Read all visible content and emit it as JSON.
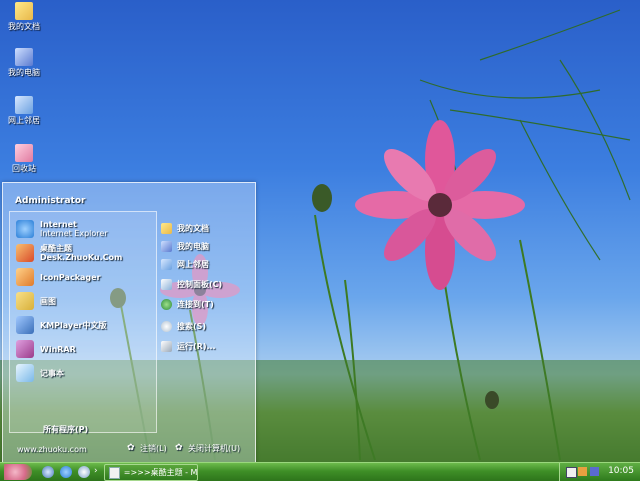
{
  "desktop": {
    "icons": [
      {
        "label": "我的文档",
        "icon": "documents-folder-icon"
      },
      {
        "label": "我的电脑",
        "icon": "computer-icon"
      },
      {
        "label": "网上邻居",
        "icon": "network-icon"
      },
      {
        "label": "回收站",
        "icon": "recycle-bin-icon"
      }
    ]
  },
  "start_menu": {
    "user": "Administrator",
    "programs": [
      {
        "title": "Internet",
        "subtitle": "Internet Explorer",
        "icon": "internet-explorer-icon",
        "color": "#2b7fd8"
      },
      {
        "title": "桌酷主题Desk.ZhuoKu.Com",
        "subtitle": "",
        "icon": "theme-app-icon",
        "color": "#d94a2a"
      },
      {
        "title": "IconPackager",
        "subtitle": "",
        "icon": "iconpackager-icon",
        "color": "#e07a2a"
      },
      {
        "title": "画图",
        "subtitle": "",
        "icon": "paint-icon",
        "color": "#d8b03a"
      },
      {
        "title": "KMPlayer中文版",
        "subtitle": "",
        "icon": "kmplayer-icon",
        "color": "#3a6fb8"
      },
      {
        "title": "WinRAR",
        "subtitle": "",
        "icon": "winrar-icon",
        "color": "#9a3a8a"
      },
      {
        "title": "记事本",
        "subtitle": "",
        "icon": "notepad-icon",
        "color": "#7ab8e8"
      }
    ],
    "all_programs": "所有程序(P)",
    "places": [
      {
        "label": "我的文档",
        "icon": "documents-folder-icon"
      },
      {
        "label": "我的电脑",
        "icon": "computer-icon"
      },
      {
        "label": "网上邻居",
        "icon": "network-icon"
      },
      {
        "label": "控制面板(C)",
        "icon": "control-panel-icon"
      },
      {
        "label": "连接到(T)",
        "icon": "connect-icon"
      },
      {
        "label": "搜索(S)",
        "icon": "search-icon"
      },
      {
        "label": "运行(R)...",
        "icon": "run-icon"
      }
    ],
    "footer": {
      "site": "www.zhuoku.com",
      "logoff": "注销(L)",
      "shutdown": "关闭计算机(U)"
    }
  },
  "taskbar": {
    "task_label": "=>>>桌酷主题 - Mi...",
    "clock": "10:05"
  }
}
